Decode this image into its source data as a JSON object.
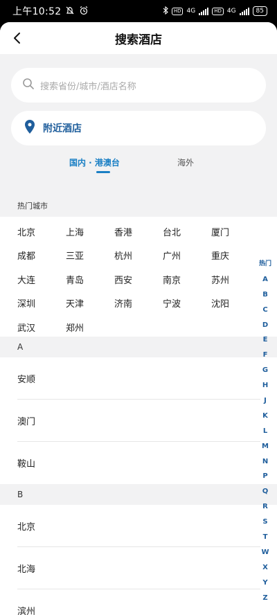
{
  "status_bar": {
    "time": "上午10:52",
    "net1": "4G",
    "net2": "4G",
    "hd1": "HD",
    "hd2": "HD",
    "battery": "85"
  },
  "nav": {
    "title": "搜索酒店"
  },
  "search": {
    "placeholder": "搜索省份/城市/酒店名称"
  },
  "nearby": {
    "label": "附近酒店"
  },
  "tabs": [
    {
      "label": "国内 · 港澳台",
      "active": true
    },
    {
      "label": "海外",
      "active": false
    }
  ],
  "hot_section": {
    "title": "热门城市",
    "rows": [
      [
        "北京",
        "上海",
        "香港",
        "台北",
        "厦门"
      ],
      [
        "成都",
        "三亚",
        "杭州",
        "广州",
        "重庆"
      ],
      [
        "大连",
        "青岛",
        "西安",
        "南京",
        "苏州"
      ],
      [
        "深圳",
        "天津",
        "济南",
        "宁波",
        "沈阳"
      ],
      [
        "武汉",
        "郑州"
      ]
    ]
  },
  "sections": [
    {
      "letter": "A",
      "cities": [
        "安顺",
        "澳门",
        "鞍山"
      ]
    },
    {
      "letter": "B",
      "cities": [
        "北京",
        "北海",
        "滨州"
      ]
    }
  ],
  "index_bar": [
    "热门",
    "A",
    "B",
    "C",
    "D",
    "E",
    "F",
    "G",
    "H",
    "J",
    "K",
    "L",
    "M",
    "N",
    "P",
    "Q",
    "R",
    "S",
    "T",
    "W",
    "X",
    "Y",
    "Z"
  ],
  "colors": {
    "accent": "#1a7fc4",
    "nav_blue": "#1f5e9c",
    "background": "#f2f2f3"
  }
}
